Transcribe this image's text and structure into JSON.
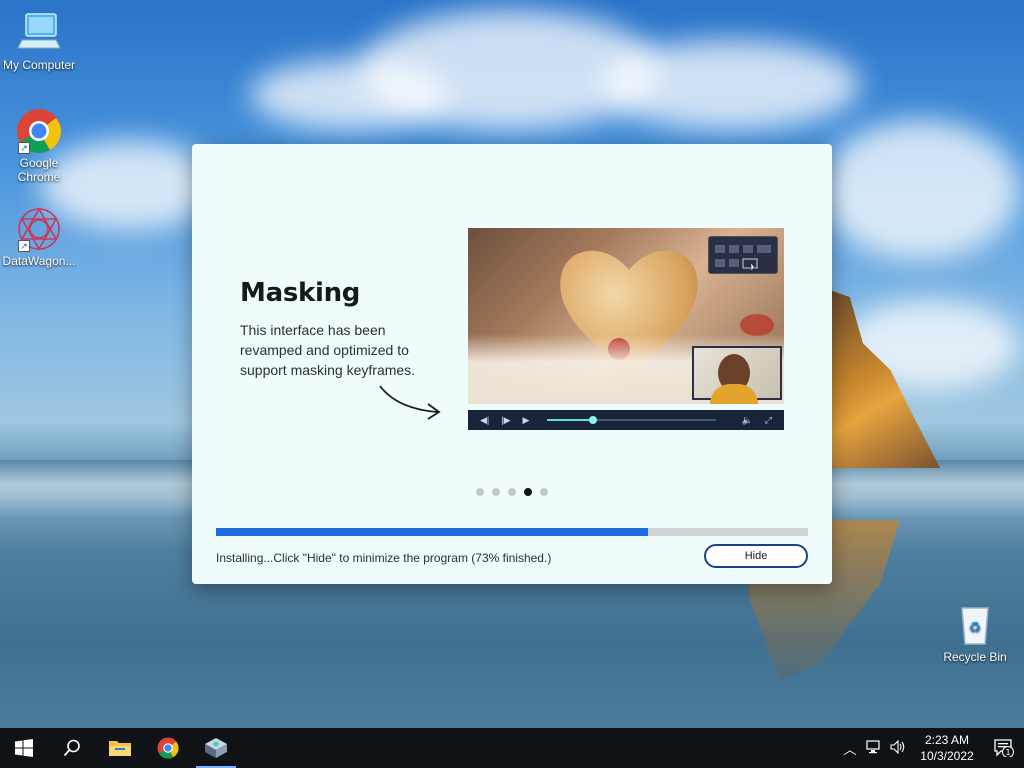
{
  "desktop": {
    "icons": [
      {
        "label": "My Computer"
      },
      {
        "label": "Google Chrome"
      },
      {
        "label": "DataWagon..."
      },
      {
        "label": "Recycle Bin"
      }
    ]
  },
  "installer": {
    "slide_title": "Masking",
    "slide_description": "This interface has been revamped and optimized to support masking keyframes.",
    "slides_total": 5,
    "active_slide_index": 3,
    "progress_percent": 73,
    "status_text": "Installing...Click \"Hide\" to minimize the program (73% finished.)",
    "hide_label": "Hide",
    "player_scrub_fraction": 0.27
  },
  "taskbar": {
    "pinned": [
      "start-button",
      "search-icon",
      "file-explorer-icon",
      "chrome-icon",
      "installer-app-icon"
    ],
    "active_app": "installer-app-icon",
    "clock_time": "2:23 AM",
    "clock_date": "10/3/2022",
    "notification_count": "1"
  },
  "colors": {
    "progress_fill": "#1d6fe0",
    "hide_border": "#1d3f8f",
    "window_bg": "#effcfb",
    "taskbar_bg": "#101316"
  }
}
